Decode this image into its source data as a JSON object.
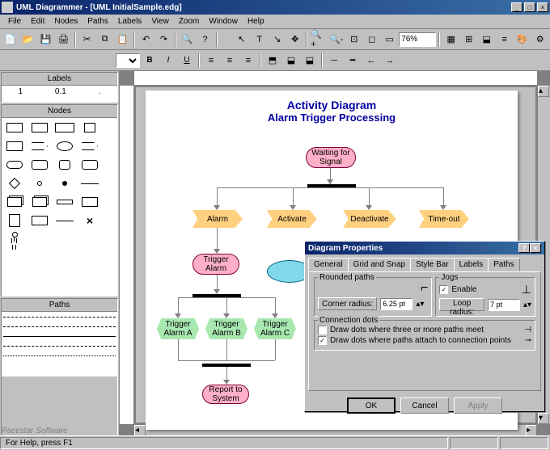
{
  "window": {
    "title": "UML Diagrammer - [UML InitialSample.edg]",
    "min": "_",
    "max": "□",
    "close": "×"
  },
  "menu": [
    "File",
    "Edit",
    "Nodes",
    "Paths",
    "Labels",
    "View",
    "Zoom",
    "Window",
    "Help"
  ],
  "toolbar": {
    "zoom": "76%"
  },
  "panels": {
    "labels": "Labels",
    "nodes": "Nodes",
    "paths": "Paths",
    "label_items": [
      "1",
      "0.1",
      "."
    ]
  },
  "diagram": {
    "title": "Activity Diagram",
    "subtitle": "Alarm Trigger Processing",
    "nodes": {
      "waiting": "Waiting for Signal",
      "alarm": "Alarm",
      "activate": "Activate",
      "deactivate": "Deactivate",
      "timeout": "Time-out",
      "trigger_alarm": "Trigger Alarm",
      "trigger_a": "Trigger Alarm A",
      "trigger_b": "Trigger Alarm B",
      "trigger_c": "Trigger Alarm C",
      "report": "Report to System"
    }
  },
  "dialog": {
    "title": "Diagram Properties",
    "tabs": [
      "General",
      "Grid and Snap",
      "Style Bar",
      "Labels",
      "Paths"
    ],
    "active_tab": "Paths",
    "rounded_group": "Rounded paths",
    "corner_label": "Corner radius:",
    "corner_value": "6.25 pt",
    "jogs_group": "Jogs",
    "enable": "Enable",
    "loop_label": "Loop radius:",
    "loop_value": "7 pt",
    "conn_group": "Connection dots",
    "conn_opt1": "Draw dots where three or more paths meet",
    "conn_opt2": "Draw dots where paths attach to connection points",
    "ok": "OK",
    "cancel": "Cancel",
    "apply": "Apply"
  },
  "status": {
    "hint": "For Help, press F1"
  },
  "branding": "Pacestar Software"
}
